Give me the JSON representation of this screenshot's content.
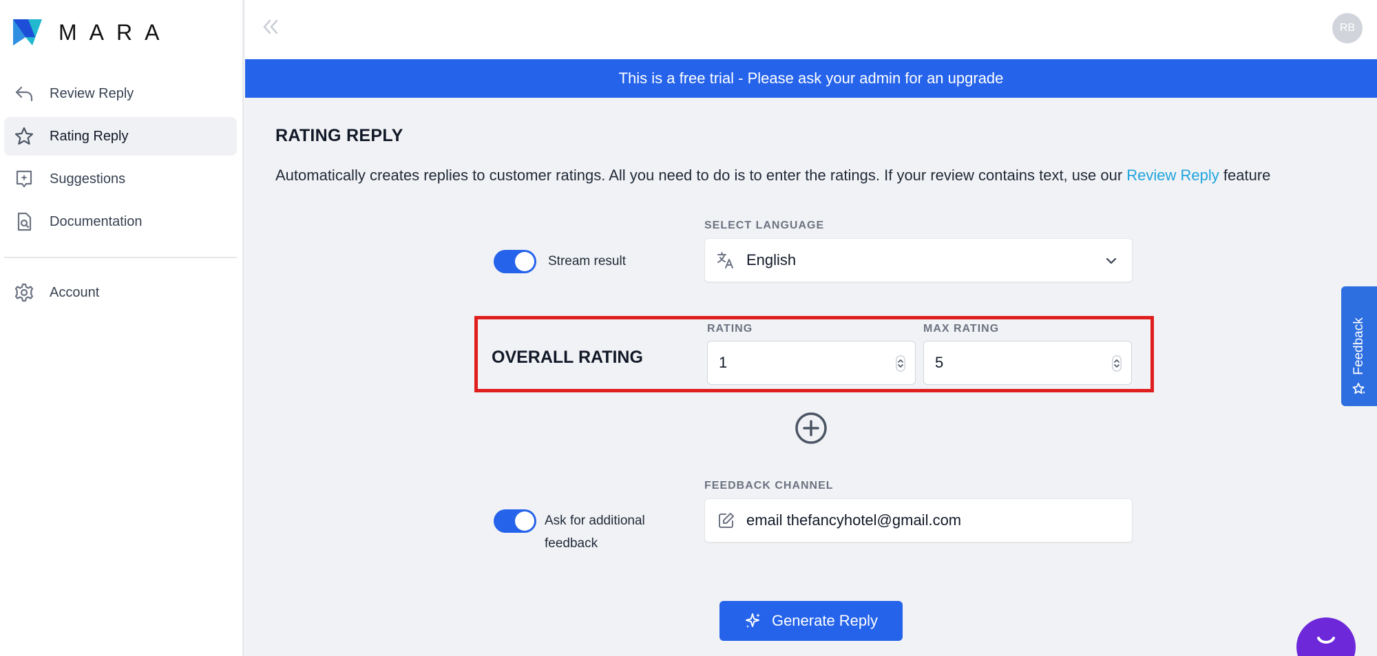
{
  "app": {
    "logo_text": "MARA",
    "brand_colors": {
      "primary": "#2563eb",
      "logo_teal": "#22b8cf",
      "logo_blue": "#1d4ed8",
      "highlight": "#e01e1e",
      "chat": "#6d28d9"
    }
  },
  "sidebar": {
    "items": [
      {
        "label": "Review Reply",
        "icon": "reply-arrow-icon",
        "active": false
      },
      {
        "label": "Rating Reply",
        "icon": "star-icon",
        "active": true
      },
      {
        "label": "Suggestions",
        "icon": "sparkle-note-icon",
        "active": false
      },
      {
        "label": "Documentation",
        "icon": "document-search-icon",
        "active": false
      },
      {
        "label": "Account",
        "icon": "gear-icon",
        "active": false
      }
    ]
  },
  "topbar": {
    "avatar_initials": "RB",
    "collapse_icon": "double-chevron-left-icon"
  },
  "banner": {
    "text": "This is a free trial - Please ask your admin for an upgrade"
  },
  "main": {
    "title": "RATING REPLY",
    "description_prefix": "Automatically creates replies to customer ratings. All you need to do is to enter the ratings. If your review contains text, use our ",
    "description_link": "Review Reply",
    "description_suffix": " feature",
    "stream_toggle": {
      "label": "Stream result",
      "on": true
    },
    "language": {
      "label": "SELECT LANGUAGE",
      "value": "English",
      "icon": "translate-icon"
    },
    "overall_rating": {
      "label": "OVERALL RATING",
      "rating_label": "RATING",
      "rating_value": "1",
      "max_rating_label": "MAX RATING",
      "max_rating_value": "5"
    },
    "add_icon": "plus-circle-icon",
    "feedback_toggle": {
      "label_line1": "Ask for additional",
      "label_line2": "feedback",
      "on": true
    },
    "feedback_channel": {
      "label": "FEEDBACK CHANNEL",
      "value": "email thefancyhotel@gmail.com",
      "icon": "edit-icon"
    },
    "generate_button": {
      "label": "Generate Reply",
      "icon": "sparkle-icon"
    }
  },
  "feedback_tab": {
    "label": "Feedback",
    "icon": "star-sparkle-icon"
  },
  "chat_widget": {
    "icon": "chat-face-icon"
  }
}
